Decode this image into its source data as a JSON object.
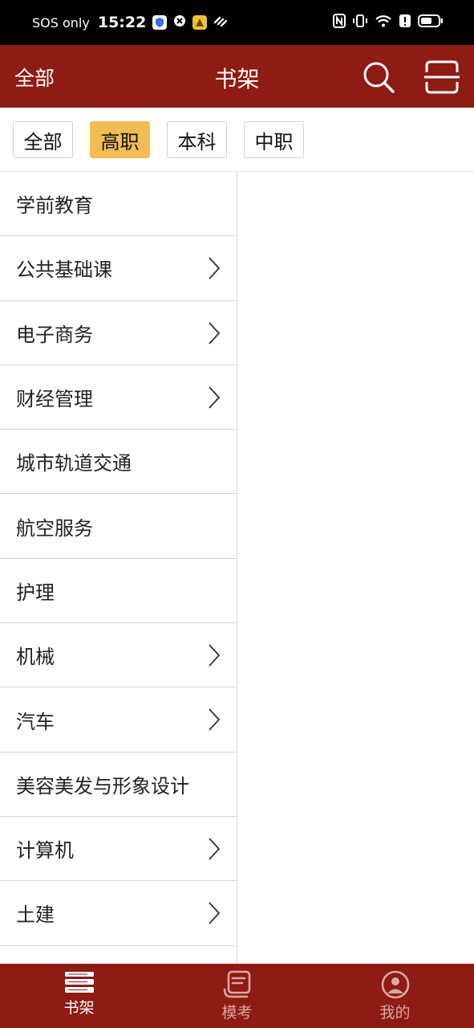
{
  "status_bar": {
    "carrier": "SOS only",
    "time": "15:22"
  },
  "app_bar": {
    "left_label": "全部",
    "title": "书架"
  },
  "filters": [
    {
      "label": "全部",
      "active": false
    },
    {
      "label": "高职",
      "active": true
    },
    {
      "label": "本科",
      "active": false
    },
    {
      "label": "中职",
      "active": false
    }
  ],
  "categories": [
    {
      "label": "学前教育",
      "has_children": false
    },
    {
      "label": "公共基础课",
      "has_children": true
    },
    {
      "label": "电子商务",
      "has_children": true
    },
    {
      "label": "财经管理",
      "has_children": true
    },
    {
      "label": "城市轨道交通",
      "has_children": false
    },
    {
      "label": "航空服务",
      "has_children": false
    },
    {
      "label": "护理",
      "has_children": false
    },
    {
      "label": "机械",
      "has_children": true
    },
    {
      "label": "汽车",
      "has_children": true
    },
    {
      "label": "美容美发与形象设计",
      "has_children": false
    },
    {
      "label": "计算机",
      "has_children": true
    },
    {
      "label": "土建",
      "has_children": true
    }
  ],
  "bottom_nav": [
    {
      "label": "书架",
      "icon": "bookshelf-icon",
      "active": true
    },
    {
      "label": "模考",
      "icon": "exam-icon",
      "active": false
    },
    {
      "label": "我的",
      "icon": "profile-icon",
      "active": false
    }
  ],
  "colors": {
    "brand": "#8e1b14",
    "chip_active": "#f1bd52"
  }
}
